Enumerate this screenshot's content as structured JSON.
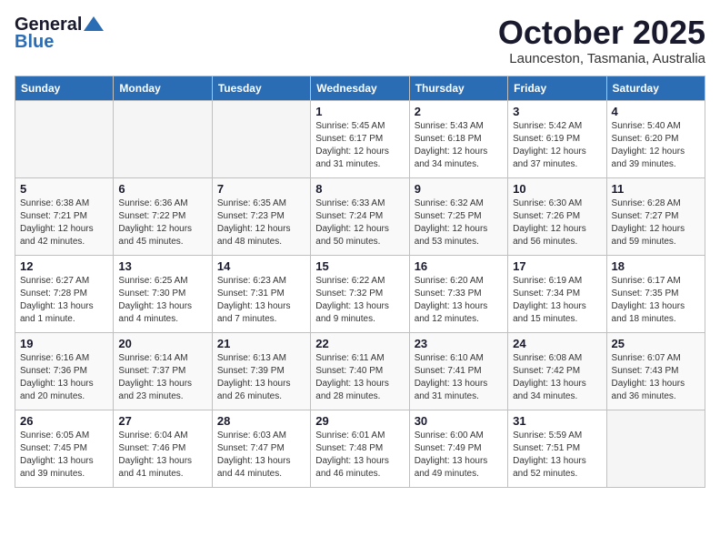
{
  "logo": {
    "general": "General",
    "blue": "Blue"
  },
  "title": {
    "month": "October 2025",
    "location": "Launceston, Tasmania, Australia"
  },
  "headers": [
    "Sunday",
    "Monday",
    "Tuesday",
    "Wednesday",
    "Thursday",
    "Friday",
    "Saturday"
  ],
  "weeks": [
    [
      {
        "day": "",
        "info": ""
      },
      {
        "day": "",
        "info": ""
      },
      {
        "day": "",
        "info": ""
      },
      {
        "day": "1",
        "info": "Sunrise: 5:45 AM\nSunset: 6:17 PM\nDaylight: 12 hours\nand 31 minutes."
      },
      {
        "day": "2",
        "info": "Sunrise: 5:43 AM\nSunset: 6:18 PM\nDaylight: 12 hours\nand 34 minutes."
      },
      {
        "day": "3",
        "info": "Sunrise: 5:42 AM\nSunset: 6:19 PM\nDaylight: 12 hours\nand 37 minutes."
      },
      {
        "day": "4",
        "info": "Sunrise: 5:40 AM\nSunset: 6:20 PM\nDaylight: 12 hours\nand 39 minutes."
      }
    ],
    [
      {
        "day": "5",
        "info": "Sunrise: 6:38 AM\nSunset: 7:21 PM\nDaylight: 12 hours\nand 42 minutes."
      },
      {
        "day": "6",
        "info": "Sunrise: 6:36 AM\nSunset: 7:22 PM\nDaylight: 12 hours\nand 45 minutes."
      },
      {
        "day": "7",
        "info": "Sunrise: 6:35 AM\nSunset: 7:23 PM\nDaylight: 12 hours\nand 48 minutes."
      },
      {
        "day": "8",
        "info": "Sunrise: 6:33 AM\nSunset: 7:24 PM\nDaylight: 12 hours\nand 50 minutes."
      },
      {
        "day": "9",
        "info": "Sunrise: 6:32 AM\nSunset: 7:25 PM\nDaylight: 12 hours\nand 53 minutes."
      },
      {
        "day": "10",
        "info": "Sunrise: 6:30 AM\nSunset: 7:26 PM\nDaylight: 12 hours\nand 56 minutes."
      },
      {
        "day": "11",
        "info": "Sunrise: 6:28 AM\nSunset: 7:27 PM\nDaylight: 12 hours\nand 59 minutes."
      }
    ],
    [
      {
        "day": "12",
        "info": "Sunrise: 6:27 AM\nSunset: 7:28 PM\nDaylight: 13 hours\nand 1 minute."
      },
      {
        "day": "13",
        "info": "Sunrise: 6:25 AM\nSunset: 7:30 PM\nDaylight: 13 hours\nand 4 minutes."
      },
      {
        "day": "14",
        "info": "Sunrise: 6:23 AM\nSunset: 7:31 PM\nDaylight: 13 hours\nand 7 minutes."
      },
      {
        "day": "15",
        "info": "Sunrise: 6:22 AM\nSunset: 7:32 PM\nDaylight: 13 hours\nand 9 minutes."
      },
      {
        "day": "16",
        "info": "Sunrise: 6:20 AM\nSunset: 7:33 PM\nDaylight: 13 hours\nand 12 minutes."
      },
      {
        "day": "17",
        "info": "Sunrise: 6:19 AM\nSunset: 7:34 PM\nDaylight: 13 hours\nand 15 minutes."
      },
      {
        "day": "18",
        "info": "Sunrise: 6:17 AM\nSunset: 7:35 PM\nDaylight: 13 hours\nand 18 minutes."
      }
    ],
    [
      {
        "day": "19",
        "info": "Sunrise: 6:16 AM\nSunset: 7:36 PM\nDaylight: 13 hours\nand 20 minutes."
      },
      {
        "day": "20",
        "info": "Sunrise: 6:14 AM\nSunset: 7:37 PM\nDaylight: 13 hours\nand 23 minutes."
      },
      {
        "day": "21",
        "info": "Sunrise: 6:13 AM\nSunset: 7:39 PM\nDaylight: 13 hours\nand 26 minutes."
      },
      {
        "day": "22",
        "info": "Sunrise: 6:11 AM\nSunset: 7:40 PM\nDaylight: 13 hours\nand 28 minutes."
      },
      {
        "day": "23",
        "info": "Sunrise: 6:10 AM\nSunset: 7:41 PM\nDaylight: 13 hours\nand 31 minutes."
      },
      {
        "day": "24",
        "info": "Sunrise: 6:08 AM\nSunset: 7:42 PM\nDaylight: 13 hours\nand 34 minutes."
      },
      {
        "day": "25",
        "info": "Sunrise: 6:07 AM\nSunset: 7:43 PM\nDaylight: 13 hours\nand 36 minutes."
      }
    ],
    [
      {
        "day": "26",
        "info": "Sunrise: 6:05 AM\nSunset: 7:45 PM\nDaylight: 13 hours\nand 39 minutes."
      },
      {
        "day": "27",
        "info": "Sunrise: 6:04 AM\nSunset: 7:46 PM\nDaylight: 13 hours\nand 41 minutes."
      },
      {
        "day": "28",
        "info": "Sunrise: 6:03 AM\nSunset: 7:47 PM\nDaylight: 13 hours\nand 44 minutes."
      },
      {
        "day": "29",
        "info": "Sunrise: 6:01 AM\nSunset: 7:48 PM\nDaylight: 13 hours\nand 46 minutes."
      },
      {
        "day": "30",
        "info": "Sunrise: 6:00 AM\nSunset: 7:49 PM\nDaylight: 13 hours\nand 49 minutes."
      },
      {
        "day": "31",
        "info": "Sunrise: 5:59 AM\nSunset: 7:51 PM\nDaylight: 13 hours\nand 52 minutes."
      },
      {
        "day": "",
        "info": ""
      }
    ]
  ]
}
